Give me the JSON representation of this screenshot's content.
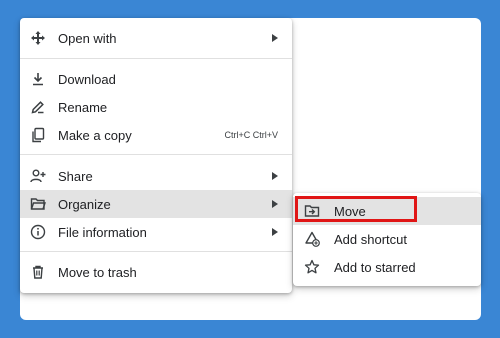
{
  "main_menu": {
    "open_with": "Open with",
    "download": "Download",
    "rename": "Rename",
    "make_copy": "Make a copy",
    "make_copy_shortcut": "Ctrl+C Ctrl+V",
    "share": "Share",
    "organize": "Organize",
    "file_information": "File information",
    "move_to_trash": "Move to trash"
  },
  "sub_menu": {
    "move": "Move",
    "add_shortcut": "Add shortcut",
    "add_to_starred": "Add to starred"
  },
  "colors": {
    "background": "#3a86d4",
    "highlight": "#e01515",
    "active_row": "#e3e3e3"
  }
}
